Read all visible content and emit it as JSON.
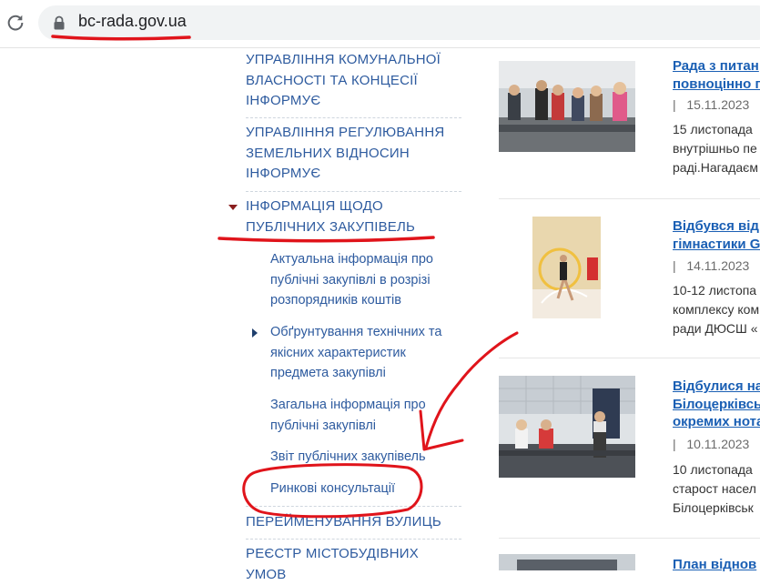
{
  "browser": {
    "url": "bc-rada.gov.ua"
  },
  "nav": {
    "items": [
      {
        "lines": [
          "УПРАВЛІННЯ КОМУНАЛЬНОЇ",
          "ВЛАСНОСТІ ТА КОНЦЕСІЇ",
          "ІНФОРМУЄ"
        ]
      },
      {
        "lines": [
          "УПРАВЛІННЯ РЕГУЛЮВАННЯ",
          "ЗЕМЕЛЬНИХ ВІДНОСИН",
          "ІНФОРМУЄ"
        ]
      },
      {
        "lines": [
          "ІНФОРМАЦІЯ ЩОДО",
          "ПУБЛІЧНИХ ЗАКУПІВЕЛЬ"
        ]
      },
      {
        "lines": [
          "ПЕРЕЙМЕНУВАННЯ ВУЛИЦЬ"
        ]
      },
      {
        "lines": [
          "РЕЄСТР МІСТОБУДІВНИХ УМОВ"
        ]
      }
    ],
    "subitems": [
      {
        "lines": [
          "Актуальна інформація про",
          "публічні закупівлі в розрізі",
          "розпорядників коштів"
        ]
      },
      {
        "lines": [
          "Обґрунтування технічних та",
          "якісних характеристик",
          "предмета закупівлі"
        ]
      },
      {
        "lines": [
          "Загальна інформація про",
          "публічні закупівлі"
        ]
      },
      {
        "lines": [
          "Звіт публічних закупівель"
        ]
      },
      {
        "lines": [
          "Ринкові консультації"
        ]
      }
    ]
  },
  "news": [
    {
      "title_lines": [
        "Рада з питан",
        "повноцінно г"
      ],
      "date": "15.11.2023",
      "text_lines": [
        "15 листопада",
        "внутрішньо пе",
        "раді.Нагадаєм"
      ]
    },
    {
      "title_lines": [
        "Відбувся від",
        "гімнастики G"
      ],
      "date": "14.11.2023",
      "text_lines": [
        "10-12 листопа",
        "комплексу ком",
        "ради ДЮСШ «"
      ]
    },
    {
      "title_lines": [
        "Відбулися на",
        "Білоцерківсь",
        "окремих нота"
      ],
      "date": "10.11.2023",
      "text_lines": [
        "10 листопада",
        "старост насел",
        "Білоцерківськ"
      ]
    },
    {
      "title_lines": [
        "План віднов"
      ],
      "date": "",
      "text_lines": []
    }
  ],
  "colors": {
    "link": "#2e5b9f",
    "news_title": "#1a5fb4",
    "annotation": "#e0141b"
  }
}
